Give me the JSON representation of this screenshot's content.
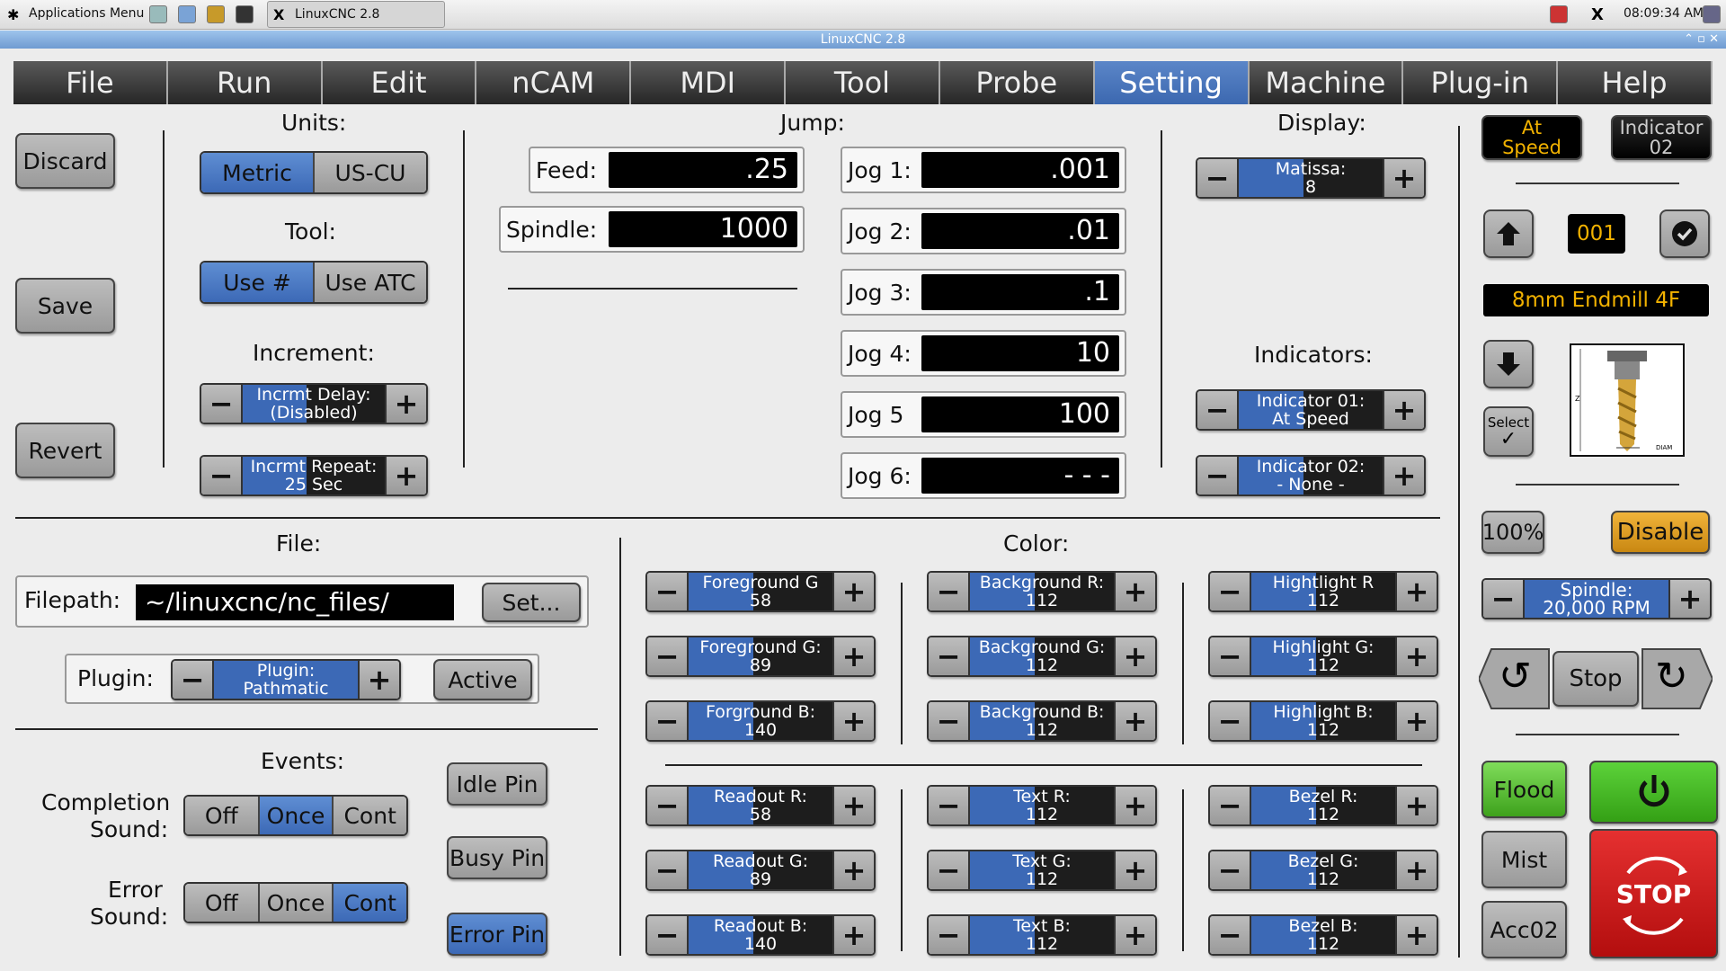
{
  "taskbar": {
    "apps_menu": "Applications Menu",
    "task": "LinuxCNC 2.8",
    "clock": "08:09:34 AM"
  },
  "window": {
    "title": "LinuxCNC 2.8"
  },
  "menu": [
    "File",
    "Run",
    "Edit",
    "nCAM",
    "MDI",
    "Tool",
    "Probe",
    "Setting",
    "Machine",
    "Plug-in",
    "Help"
  ],
  "menu_active": "Setting",
  "left_buttons": {
    "discard": "Discard",
    "save": "Save",
    "revert": "Revert"
  },
  "units": {
    "title": "Units:",
    "metric": "Metric",
    "uscu": "US-CU"
  },
  "tool": {
    "title": "Tool:",
    "use_num": "Use #",
    "use_atc": "Use ATC"
  },
  "increment": {
    "title": "Increment:",
    "delay_l1": "Incrmt Delay:",
    "delay_l2": "(Disabled)",
    "repeat_l1": "Incrmt Repeat:",
    "repeat_l2": "25 Sec"
  },
  "jump": {
    "title": "Jump:",
    "feed_label": "Feed:",
    "feed_value": ".25",
    "spindle_label": "Spindle:",
    "spindle_value": "1000"
  },
  "jogs": [
    {
      "label": "Jog 1:",
      "value": ".001"
    },
    {
      "label": "Jog 2:",
      "value": ".01"
    },
    {
      "label": "Jog 3:",
      "value": ".1"
    },
    {
      "label": "Jog 4:",
      "value": "10"
    },
    {
      "label": "Jog 5",
      "value": "100"
    },
    {
      "label": "Jog 6:",
      "value": "- - -"
    }
  ],
  "display": {
    "title": "Display:",
    "matissa_l1": "Matissa:",
    "matissa_l2": "8"
  },
  "indicators": {
    "title": "Indicators:",
    "ind1_l1": "Indicator 01:",
    "ind1_l2": "At Speed",
    "ind2_l1": "Indicator 02:",
    "ind2_l2": "- None -"
  },
  "file": {
    "title": "File:",
    "filepath_label": "Filepath:",
    "filepath_value": "~/linuxcnc/nc_files/",
    "set": "Set...",
    "plugin_label": "Plugin:",
    "plugin_l1": "Plugin:",
    "plugin_l2": "Pathmatic",
    "active": "Active"
  },
  "events": {
    "title": "Events:",
    "completion_l1": "Completion",
    "completion_l2": "Sound:",
    "error_l1": "Error",
    "error_l2": "Sound:",
    "off": "Off",
    "once": "Once",
    "cont": "Cont",
    "idle_pin": "Idle Pin",
    "busy_pin": "Busy Pin",
    "error_pin": "Error Pin"
  },
  "color": {
    "title": "Color:",
    "items": [
      {
        "l1": "Foreground G",
        "l2": "58"
      },
      {
        "l1": "Background R:",
        "l2": "112"
      },
      {
        "l1": "Hightlight R",
        "l2": "112"
      },
      {
        "l1": "Foreground  G:",
        "l2": "89"
      },
      {
        "l1": "Background G:",
        "l2": "112"
      },
      {
        "l1": "Highlight G:",
        "l2": "112"
      },
      {
        "l1": "Forground B:",
        "l2": "140"
      },
      {
        "l1": "Background B:",
        "l2": "112"
      },
      {
        "l1": "Highlight B:",
        "l2": "112"
      },
      {
        "l1": "Readout R:",
        "l2": "58"
      },
      {
        "l1": "Text R:",
        "l2": "112"
      },
      {
        "l1": "Bezel R:",
        "l2": "112"
      },
      {
        "l1": "Readout G:",
        "l2": "89"
      },
      {
        "l1": "Text G:",
        "l2": "112"
      },
      {
        "l1": "Bezel G:",
        "l2": "112"
      },
      {
        "l1": "Readout B:",
        "l2": "140"
      },
      {
        "l1": "Text B:",
        "l2": "112"
      },
      {
        "l1": "Bezel B:",
        "l2": "112"
      }
    ]
  },
  "right": {
    "at_speed_l1": "At",
    "at_speed_l2": "Speed",
    "indicator_l1": "Indicator",
    "indicator_l2": "02",
    "tool_number": "001",
    "tool_name": "8mm Endmill 4F",
    "select": "Select",
    "pct": "100%",
    "disable": "Disable",
    "spindle_l1": "Spindle:",
    "spindle_l2": "20,000 RPM",
    "stop": "Stop",
    "flood": "Flood",
    "mist": "Mist",
    "acc": "Acc02",
    "estop": "STOP",
    "diag_z": "Z",
    "diag_diam": "DIAM"
  },
  "colors": {
    "accent_blue": "#3c69b6",
    "active_tab": "#4a78c0",
    "amber": "#f2b200",
    "power_green": "#4caf2a",
    "estop_red": "#d21a1a"
  }
}
